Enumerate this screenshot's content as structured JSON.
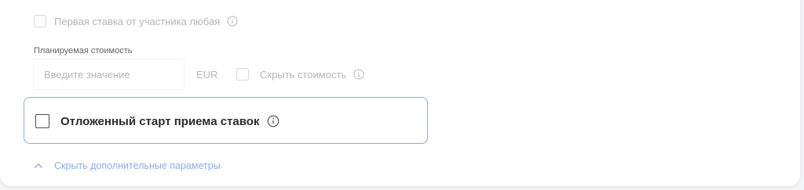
{
  "options": {
    "first_bid_label": "Первая ставка от участника любая"
  },
  "planned_cost": {
    "label": "Планируемая стоимость",
    "placeholder": "Введите значение",
    "value": "",
    "currency": "EUR",
    "hide_cost_label": "Скрыть стоимость"
  },
  "deferred_start": {
    "label": "Отложенный старт приема ставок"
  },
  "toggle_extra": {
    "label": "Скрыть дополнительные параметры"
  },
  "colors": {
    "accent_border": "#8fa9dc",
    "link": "#8aaee8",
    "muted": "#b3b5ba"
  },
  "icons": {
    "info": "info-icon",
    "chevron": "chevron-up-icon"
  }
}
